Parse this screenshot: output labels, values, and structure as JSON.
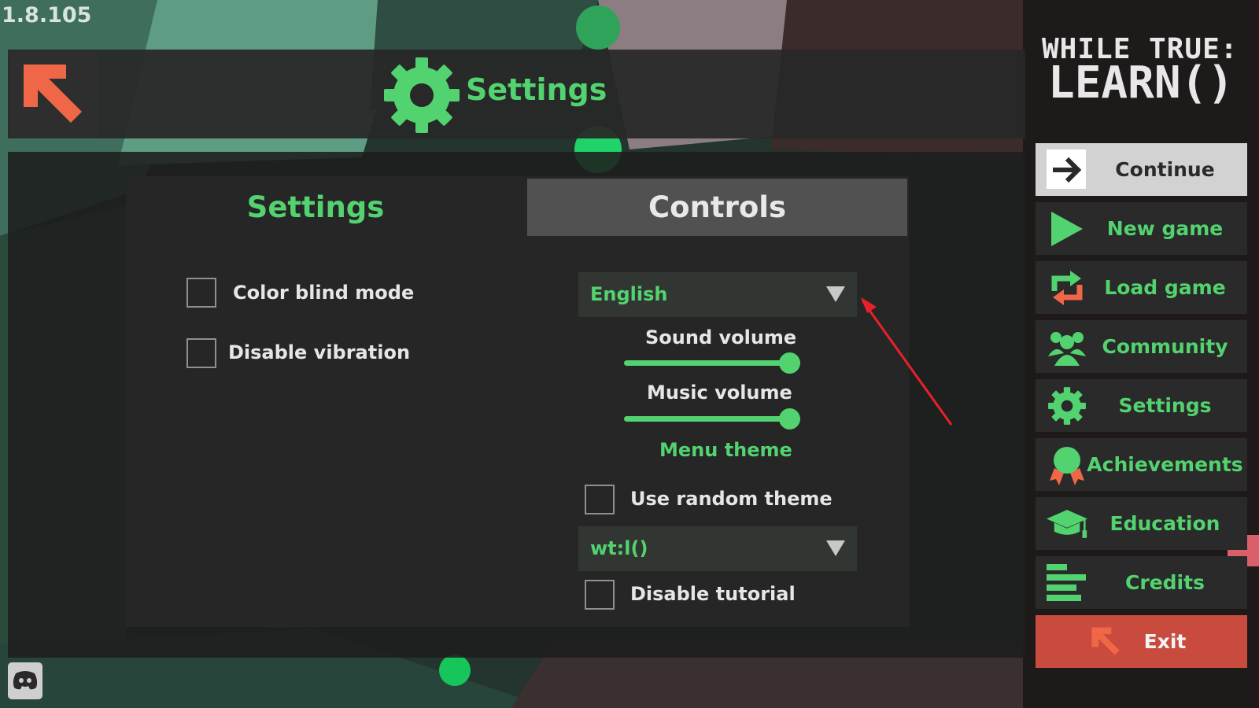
{
  "version": "1.8.105",
  "header": {
    "title": "Settings"
  },
  "tabs": [
    {
      "label": "Settings",
      "active": true
    },
    {
      "label": "Controls",
      "active": false
    }
  ],
  "settings": {
    "color_blind_mode": {
      "label": "Color blind mode",
      "checked": false
    },
    "disable_vibration": {
      "label": "Disable vibration",
      "checked": false
    },
    "language": {
      "value": "English"
    },
    "sound_volume": {
      "label": "Sound volume",
      "value": 1.0
    },
    "music_volume": {
      "label": "Music volume",
      "value": 1.0
    },
    "menu_theme": {
      "label": "Menu theme"
    },
    "use_random_theme": {
      "label": "Use random theme",
      "checked": false
    },
    "theme": {
      "value": "wt:l()"
    },
    "disable_tutorial": {
      "label": "Disable tutorial",
      "checked": false
    }
  },
  "logo": {
    "line1": "WHILE TRUE:",
    "line2": "LEARN()"
  },
  "menu": [
    {
      "label": "Continue",
      "icon": "arrow-right-icon"
    },
    {
      "label": "New game",
      "icon": "play-icon"
    },
    {
      "label": "Load game",
      "icon": "reload-icon"
    },
    {
      "label": "Community",
      "icon": "people-icon"
    },
    {
      "label": "Settings",
      "icon": "gear-icon"
    },
    {
      "label": "Achievements",
      "icon": "medal-icon"
    },
    {
      "label": "Education",
      "icon": "graduation-cap-icon"
    },
    {
      "label": "Credits",
      "icon": "lines-icon"
    },
    {
      "label": "Exit",
      "icon": "exit-arrow-icon"
    }
  ],
  "colors": {
    "accent": "#52d36f",
    "exit": "#c84b3e",
    "back_arrow": "#f06748",
    "annotation": "#e8212a"
  }
}
